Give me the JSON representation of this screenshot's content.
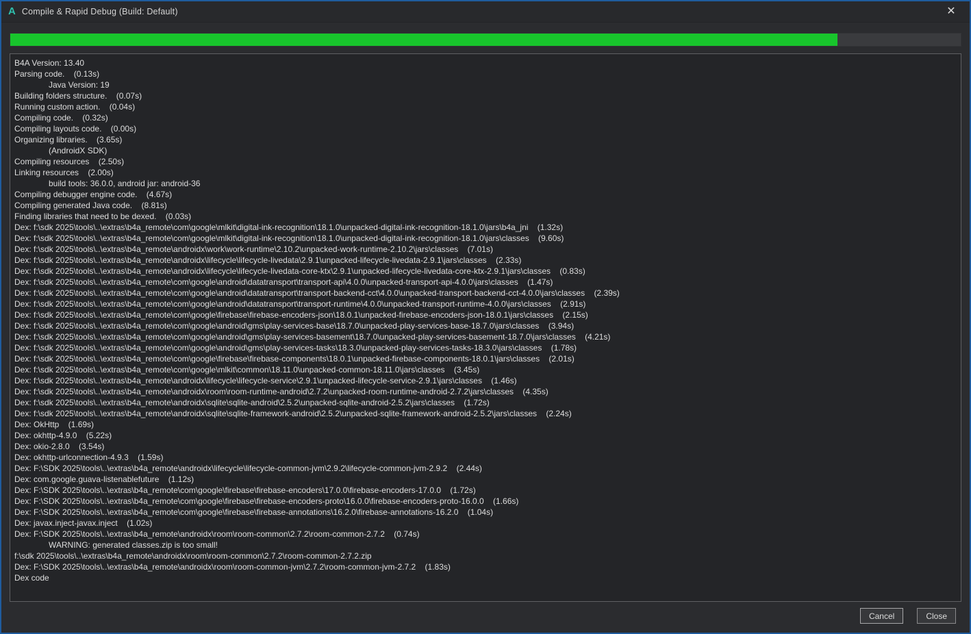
{
  "window": {
    "app_icon": "A",
    "title": "Compile & Rapid Debug (Build: Default)",
    "close_glyph": "✕",
    "accent_border_color": "#1f5c9e",
    "logo_color": "#2fc0ae"
  },
  "progress": {
    "percent": 87,
    "fill_color": "#18c52c",
    "track_color": "#3a3b3e"
  },
  "log": {
    "lines": [
      {
        "t": "B4A Version: 13.40",
        "i": 0
      },
      {
        "t": "Parsing code.    (0.13s)",
        "i": 0
      },
      {
        "t": "Java Version: 19",
        "i": 1
      },
      {
        "t": "Building folders structure.    (0.07s)",
        "i": 0
      },
      {
        "t": "Running custom action.    (0.04s)",
        "i": 0
      },
      {
        "t": "Compiling code.    (0.32s)",
        "i": 0
      },
      {
        "t": "Compiling layouts code.    (0.00s)",
        "i": 0
      },
      {
        "t": "Organizing libraries.    (3.65s)",
        "i": 0
      },
      {
        "t": "(AndroidX SDK)",
        "i": 1
      },
      {
        "t": "Compiling resources    (2.50s)",
        "i": 0
      },
      {
        "t": "Linking resources    (2.00s)",
        "i": 0
      },
      {
        "t": "build tools: 36.0.0, android jar: android-36",
        "i": 1
      },
      {
        "t": "Compiling debugger engine code.    (4.67s)",
        "i": 0
      },
      {
        "t": "Compiling generated Java code.    (8.81s)",
        "i": 0
      },
      {
        "t": "Finding libraries that need to be dexed.    (0.03s)",
        "i": 0
      },
      {
        "t": "Dex: f:\\sdk 2025\\tools\\..\\extras\\b4a_remote\\com\\google\\mlkit\\digital-ink-recognition\\18.1.0\\unpacked-digital-ink-recognition-18.1.0\\jars\\b4a_jni    (1.32s)",
        "i": 0
      },
      {
        "t": "Dex: f:\\sdk 2025\\tools\\..\\extras\\b4a_remote\\com\\google\\mlkit\\digital-ink-recognition\\18.1.0\\unpacked-digital-ink-recognition-18.1.0\\jars\\classes    (9.60s)",
        "i": 0
      },
      {
        "t": "Dex: f:\\sdk 2025\\tools\\..\\extras\\b4a_remote\\androidx\\work\\work-runtime\\2.10.2\\unpacked-work-runtime-2.10.2\\jars\\classes    (7.01s)",
        "i": 0
      },
      {
        "t": "Dex: f:\\sdk 2025\\tools\\..\\extras\\b4a_remote\\androidx\\lifecycle\\lifecycle-livedata\\2.9.1\\unpacked-lifecycle-livedata-2.9.1\\jars\\classes    (2.33s)",
        "i": 0
      },
      {
        "t": "Dex: f:\\sdk 2025\\tools\\..\\extras\\b4a_remote\\androidx\\lifecycle\\lifecycle-livedata-core-ktx\\2.9.1\\unpacked-lifecycle-livedata-core-ktx-2.9.1\\jars\\classes    (0.83s)",
        "i": 0
      },
      {
        "t": "Dex: f:\\sdk 2025\\tools\\..\\extras\\b4a_remote\\com\\google\\android\\datatransport\\transport-api\\4.0.0\\unpacked-transport-api-4.0.0\\jars\\classes    (1.47s)",
        "i": 0
      },
      {
        "t": "Dex: f:\\sdk 2025\\tools\\..\\extras\\b4a_remote\\com\\google\\android\\datatransport\\transport-backend-cct\\4.0.0\\unpacked-transport-backend-cct-4.0.0\\jars\\classes    (2.39s)",
        "i": 0
      },
      {
        "t": "Dex: f:\\sdk 2025\\tools\\..\\extras\\b4a_remote\\com\\google\\android\\datatransport\\transport-runtime\\4.0.0\\unpacked-transport-runtime-4.0.0\\jars\\classes    (2.91s)",
        "i": 0
      },
      {
        "t": "Dex: f:\\sdk 2025\\tools\\..\\extras\\b4a_remote\\com\\google\\firebase\\firebase-encoders-json\\18.0.1\\unpacked-firebase-encoders-json-18.0.1\\jars\\classes    (2.15s)",
        "i": 0
      },
      {
        "t": "Dex: f:\\sdk 2025\\tools\\..\\extras\\b4a_remote\\com\\google\\android\\gms\\play-services-base\\18.7.0\\unpacked-play-services-base-18.7.0\\jars\\classes    (3.94s)",
        "i": 0
      },
      {
        "t": "Dex: f:\\sdk 2025\\tools\\..\\extras\\b4a_remote\\com\\google\\android\\gms\\play-services-basement\\18.7.0\\unpacked-play-services-basement-18.7.0\\jars\\classes    (4.21s)",
        "i": 0
      },
      {
        "t": "Dex: f:\\sdk 2025\\tools\\..\\extras\\b4a_remote\\com\\google\\android\\gms\\play-services-tasks\\18.3.0\\unpacked-play-services-tasks-18.3.0\\jars\\classes    (1.78s)",
        "i": 0
      },
      {
        "t": "Dex: f:\\sdk 2025\\tools\\..\\extras\\b4a_remote\\com\\google\\firebase\\firebase-components\\18.0.1\\unpacked-firebase-components-18.0.1\\jars\\classes    (2.01s)",
        "i": 0
      },
      {
        "t": "Dex: f:\\sdk 2025\\tools\\..\\extras\\b4a_remote\\com\\google\\mlkit\\common\\18.11.0\\unpacked-common-18.11.0\\jars\\classes    (3.45s)",
        "i": 0
      },
      {
        "t": "Dex: f:\\sdk 2025\\tools\\..\\extras\\b4a_remote\\androidx\\lifecycle\\lifecycle-service\\2.9.1\\unpacked-lifecycle-service-2.9.1\\jars\\classes    (1.46s)",
        "i": 0
      },
      {
        "t": "Dex: f:\\sdk 2025\\tools\\..\\extras\\b4a_remote\\androidx\\room\\room-runtime-android\\2.7.2\\unpacked-room-runtime-android-2.7.2\\jars\\classes    (4.35s)",
        "i": 0
      },
      {
        "t": "Dex: f:\\sdk 2025\\tools\\..\\extras\\b4a_remote\\androidx\\sqlite\\sqlite-android\\2.5.2\\unpacked-sqlite-android-2.5.2\\jars\\classes    (1.72s)",
        "i": 0
      },
      {
        "t": "Dex: f:\\sdk 2025\\tools\\..\\extras\\b4a_remote\\androidx\\sqlite\\sqlite-framework-android\\2.5.2\\unpacked-sqlite-framework-android-2.5.2\\jars\\classes    (2.24s)",
        "i": 0
      },
      {
        "t": "Dex: OkHttp    (1.69s)",
        "i": 0
      },
      {
        "t": "Dex: okhttp-4.9.0    (5.22s)",
        "i": 0
      },
      {
        "t": "Dex: okio-2.8.0    (3.54s)",
        "i": 0
      },
      {
        "t": "Dex: okhttp-urlconnection-4.9.3    (1.59s)",
        "i": 0
      },
      {
        "t": "Dex: F:\\SDK 2025\\tools\\..\\extras\\b4a_remote\\androidx\\lifecycle\\lifecycle-common-jvm\\2.9.2\\lifecycle-common-jvm-2.9.2    (2.44s)",
        "i": 0
      },
      {
        "t": "Dex: com.google.guava-listenablefuture    (1.12s)",
        "i": 0
      },
      {
        "t": "Dex: F:\\SDK 2025\\tools\\..\\extras\\b4a_remote\\com\\google\\firebase\\firebase-encoders\\17.0.0\\firebase-encoders-17.0.0    (1.72s)",
        "i": 0
      },
      {
        "t": "Dex: F:\\SDK 2025\\tools\\..\\extras\\b4a_remote\\com\\google\\firebase\\firebase-encoders-proto\\16.0.0\\firebase-encoders-proto-16.0.0    (1.66s)",
        "i": 0
      },
      {
        "t": "Dex: F:\\SDK 2025\\tools\\..\\extras\\b4a_remote\\com\\google\\firebase\\firebase-annotations\\16.2.0\\firebase-annotations-16.2.0    (1.04s)",
        "i": 0
      },
      {
        "t": "Dex: javax.inject-javax.inject    (1.02s)",
        "i": 0
      },
      {
        "t": "Dex: F:\\SDK 2025\\tools\\..\\extras\\b4a_remote\\androidx\\room\\room-common\\2.7.2\\room-common-2.7.2    (0.74s)",
        "i": 0
      },
      {
        "t": "WARNING: generated classes.zip is too small!",
        "i": 1
      },
      {
        "t": "f:\\sdk 2025\\tools\\..\\extras\\b4a_remote\\androidx\\room\\room-common\\2.7.2\\room-common-2.7.2.zip",
        "i": 0
      },
      {
        "t": "Dex: F:\\SDK 2025\\tools\\..\\extras\\b4a_remote\\androidx\\room\\room-common-jvm\\2.7.2\\room-common-jvm-2.7.2    (1.83s)",
        "i": 0
      },
      {
        "t": "Dex code",
        "i": 0
      }
    ]
  },
  "footer": {
    "cancel_label": "Cancel",
    "close_label": "Close"
  }
}
